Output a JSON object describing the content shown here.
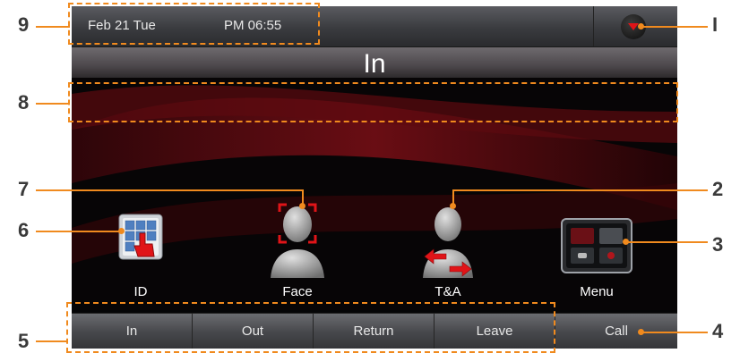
{
  "header": {
    "date": "Feb 21 Tue",
    "time": "PM 06:55"
  },
  "mode": {
    "title": "In"
  },
  "icons": [
    {
      "id": "id",
      "label": "ID"
    },
    {
      "id": "face",
      "label": "Face"
    },
    {
      "id": "ta",
      "label": "T&A"
    },
    {
      "id": "menu",
      "label": "Menu"
    }
  ],
  "bottom_buttons": [
    {
      "label": "In"
    },
    {
      "label": "Out"
    },
    {
      "label": "Return"
    },
    {
      "label": "Leave"
    },
    {
      "label": "Call"
    }
  ],
  "callouts": [
    "1",
    "2",
    "3",
    "4",
    "5",
    "6",
    "7",
    "8",
    "9"
  ],
  "callout_glyphs": {
    "one": "I"
  },
  "colors": {
    "accent": "#f08a1e",
    "alert_red": "#e01418",
    "background": "#050506"
  }
}
